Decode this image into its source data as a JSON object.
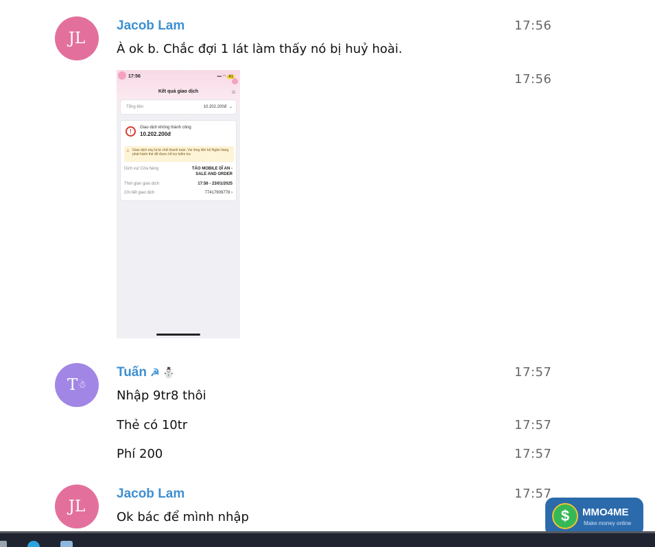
{
  "messages": [
    {
      "initials": "JL",
      "name": "Jacob Lam",
      "text": "À ok b. Chắc đợi 1 lát làm thấy nó bị huỷ hoài.",
      "time": "17:56",
      "image_time": "17:56"
    },
    {
      "initials": "T",
      "name": "Tuấn",
      "name_emoji": "☭ ⛄",
      "text": "Nhập 9tr8 thôi",
      "time": "17:57",
      "followups": [
        {
          "text": "Thẻ có 10tr",
          "time": "17:57"
        },
        {
          "text": "Phí 200",
          "time": "17:57"
        }
      ]
    },
    {
      "initials": "JL",
      "name": "Jacob Lam",
      "text": "Ok bác để mình nhập",
      "time": "17:57"
    }
  ],
  "screenshot": {
    "status_time": "17:56",
    "battery": "41",
    "title": "Kết quả giao dịch",
    "total_label": "Tổng tiền",
    "total_value": "10.202.200đ",
    "status_label": "Giao dịch không thành công",
    "status_amount": "10.202.200đ",
    "alert_text": "Giao dịch này bị từ chối thanh toán. Vui lòng liên hệ Ngân hàng phát hành thẻ để được hỗ trợ kiểm tra",
    "service_label": "Dịch vụ/ Cửa hàng",
    "service_value": "TÁO MOBILE DĨ AN - SALE AND ORDER",
    "time_label": "Thời gian giao dịch",
    "time_value": "17:56 - 23/01/2025",
    "detail_label": "Chi tiết giao dịch",
    "detail_value": "77417909778 ›"
  },
  "watermark": {
    "brand": "MMO4ME",
    "tagline": "Make money online"
  },
  "colors": {
    "name": "#3d8fd1",
    "avatar_pink": "#e3709c",
    "avatar_purple": "#a186e6"
  }
}
